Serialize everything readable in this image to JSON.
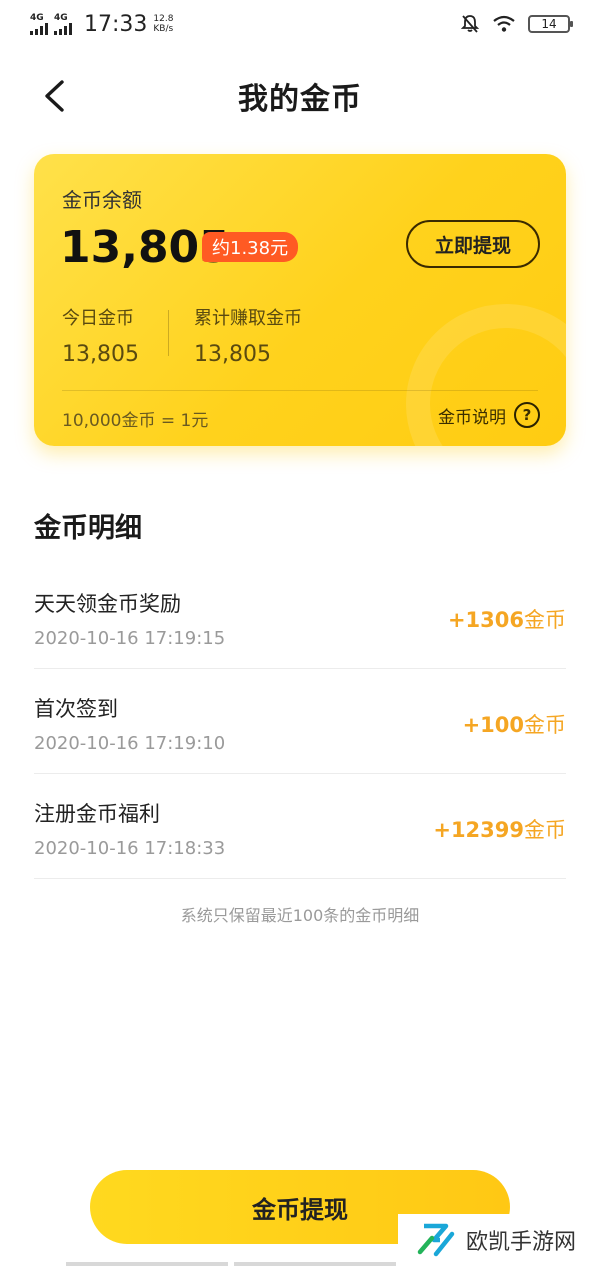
{
  "status_bar": {
    "network1": "4G",
    "network2": "4G",
    "time": "17:33",
    "speed_value": "12.8",
    "speed_unit": "KB/s",
    "battery": "14"
  },
  "header": {
    "title": "我的金币"
  },
  "balance_card": {
    "label": "金币余额",
    "value": "13,805",
    "approx": "约1.38元",
    "withdraw_label": "立即提现",
    "today_label": "今日金币",
    "today_value": "13,805",
    "total_label": "累计赚取金币",
    "total_value": "13,805",
    "rate": "10,000金币 = 1元",
    "explain_label": "金币说明"
  },
  "details": {
    "title": "金币明细",
    "unit": "金币",
    "items": [
      {
        "name": "天天领金币奖励",
        "date": "2020-10-16 17:19:15",
        "amount": "+1306"
      },
      {
        "name": "首次签到",
        "date": "2020-10-16 17:19:10",
        "amount": "+100"
      },
      {
        "name": "注册金币福利",
        "date": "2020-10-16 17:18:33",
        "amount": "+12399"
      }
    ],
    "note": "系统只保留最近100条的金币明细"
  },
  "bottom": {
    "button_label": "金币提现"
  },
  "watermark": {
    "text": "欧凯手游网"
  },
  "colors": {
    "accent": "#ffd21c",
    "amount": "#f5a623",
    "badge": "#ff5a23"
  }
}
